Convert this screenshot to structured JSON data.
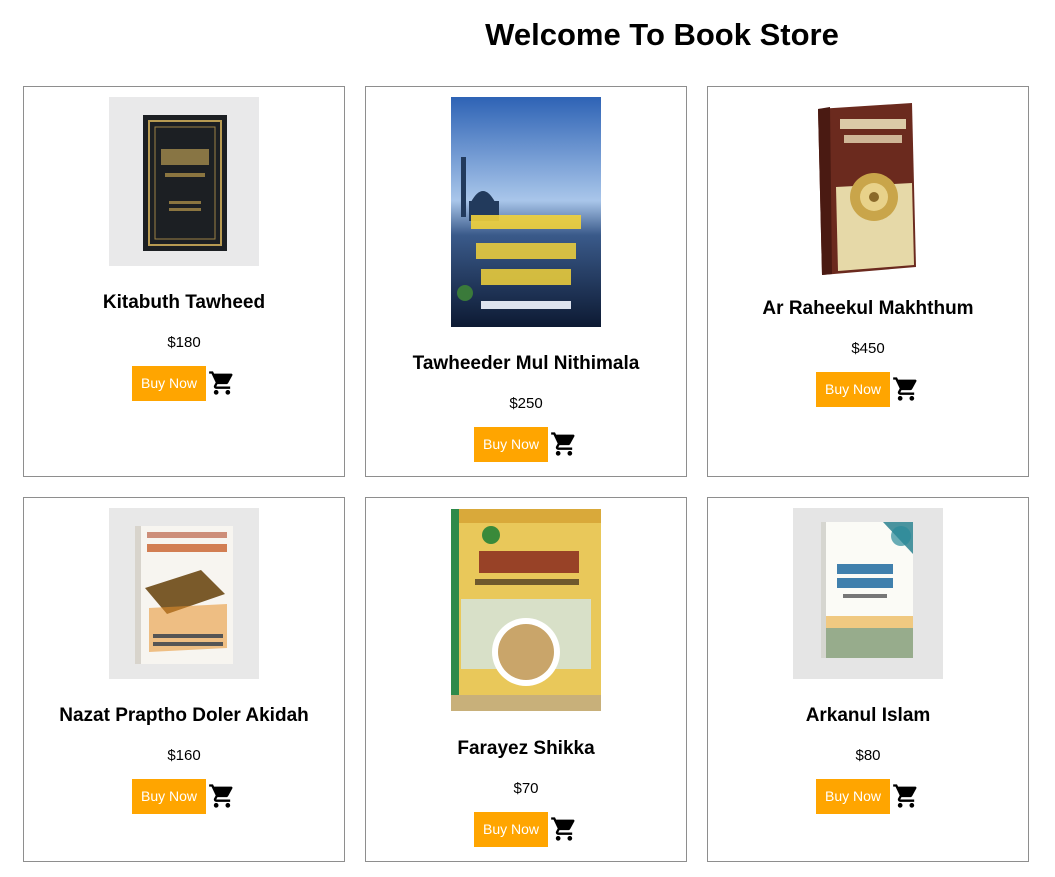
{
  "header": {
    "title": "Welcome To Book Store"
  },
  "theme": {
    "button_color": "#ffa500",
    "button_text_color": "#ffffff",
    "border_color": "#8e8e8e"
  },
  "books": [
    {
      "title": "Kitabuth Tawheed",
      "price": "$180",
      "button_label": "Buy Now",
      "cart_icon": "shopping-cart-icon",
      "cover": "dark-green-book-cover"
    },
    {
      "title": "Tawheeder Mul Nithimala",
      "price": "$250",
      "button_label": "Buy Now",
      "cart_icon": "shopping-cart-icon",
      "cover": "blue-sky-mosque-book-cover"
    },
    {
      "title": "Ar Raheekul Makhthum",
      "price": "$450",
      "button_label": "Buy Now",
      "cart_icon": "shopping-cart-icon",
      "cover": "brown-hardcover-book"
    },
    {
      "title": "Nazat Praptho Doler Akidah",
      "price": "$160",
      "button_label": "Buy Now",
      "cart_icon": "shopping-cart-icon",
      "cover": "white-orange-book-cover"
    },
    {
      "title": "Farayez Shikka",
      "price": "$70",
      "button_label": "Buy Now",
      "cart_icon": "shopping-cart-icon",
      "cover": "yellow-green-book-cover"
    },
    {
      "title": "Arkanul Islam",
      "price": "$80",
      "button_label": "Buy Now",
      "cart_icon": "shopping-cart-icon",
      "cover": "white-teal-book-cover"
    }
  ]
}
